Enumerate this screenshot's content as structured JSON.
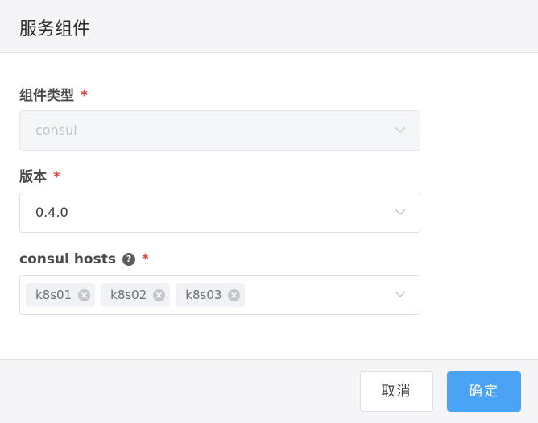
{
  "dialog": {
    "title": "服务组件"
  },
  "form": {
    "component_type": {
      "label": "组件类型",
      "required_mark": "*",
      "value": "consul",
      "disabled": true
    },
    "version": {
      "label": "版本",
      "required_mark": "*",
      "value": "0.4.0"
    },
    "hosts": {
      "label": "consul hosts",
      "help_glyph": "?",
      "required_mark": "*",
      "tags": [
        "k8s01",
        "k8s02",
        "k8s03"
      ]
    }
  },
  "footer": {
    "cancel_label": "取消",
    "confirm_label": "确定"
  },
  "colors": {
    "primary": "#4aa3f5",
    "required": "#e0453f",
    "header_bg": "#f5f5f7"
  },
  "icons": {
    "dropdown": "chevron-down-icon",
    "tag_close": "close-circle-icon",
    "help": "question-circle-icon"
  }
}
